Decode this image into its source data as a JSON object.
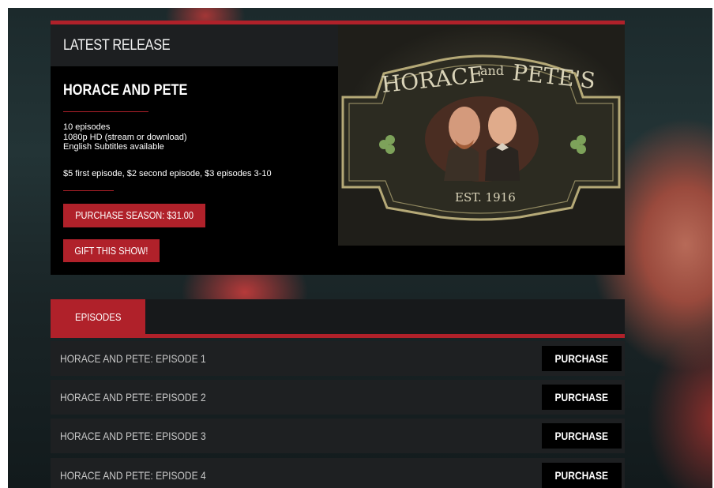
{
  "colors": {
    "accent": "#b0212a",
    "panel": "#000000",
    "row": "#1e2022"
  },
  "release": {
    "heading": "LATEST RELEASE",
    "title": "HORACE AND PETE",
    "specs": [
      "10 episodes",
      "1080p HD (stream or download)",
      "English Subtitles available"
    ],
    "pricing": "$5 first episode, $2 second episode, $3 episodes 3-10",
    "purchase_label": "PURCHASE SEASON: $31.00",
    "gift_label": "GIFT THIS SHOW!"
  },
  "poster": {
    "sign_text_left": "HORACE",
    "sign_text_and": "and",
    "sign_text_right": "PETE'S",
    "est": "EST. 1916"
  },
  "tabs": {
    "active": "EPISODES"
  },
  "episodes": [
    {
      "title": "HORACE AND PETE: EPISODE 1",
      "action": "PURCHASE"
    },
    {
      "title": "HORACE AND PETE: EPISODE 2",
      "action": "PURCHASE"
    },
    {
      "title": "HORACE AND PETE: EPISODE 3",
      "action": "PURCHASE"
    },
    {
      "title": "HORACE AND PETE: EPISODE 4",
      "action": "PURCHASE"
    }
  ]
}
